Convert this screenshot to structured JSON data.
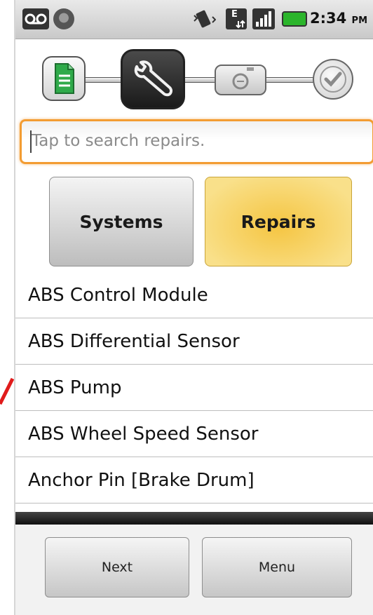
{
  "status_bar": {
    "icons": [
      "voicemail-icon",
      "usb-debug-icon",
      "vibrate-icon",
      "data-transfer-icon",
      "signal-icon",
      "battery-icon"
    ],
    "data_label": "E",
    "time": "2:34",
    "time_suffix": "PM",
    "battery_color": "#2bb52b"
  },
  "progress_steps": {
    "icons": [
      "document-icon",
      "wrench-icon",
      "camera-icon",
      "checkmark-icon"
    ],
    "active_index": 1
  },
  "search": {
    "placeholder": "Tap to search repairs.",
    "value": "",
    "focus_color": "#f39c32"
  },
  "tabs": [
    {
      "label": "Systems",
      "selected": false
    },
    {
      "label": "Repairs",
      "selected": true,
      "color": "#f5c542"
    }
  ],
  "repairs": [
    "ABS Control Module",
    "ABS Differential Sensor",
    "ABS Pump",
    "ABS Wheel Speed Sensor",
    "Anchor Pin [Brake Drum]"
  ],
  "buttons": {
    "next": "Next",
    "menu": "Menu"
  },
  "annotation": {
    "color": "#e01b1b"
  }
}
